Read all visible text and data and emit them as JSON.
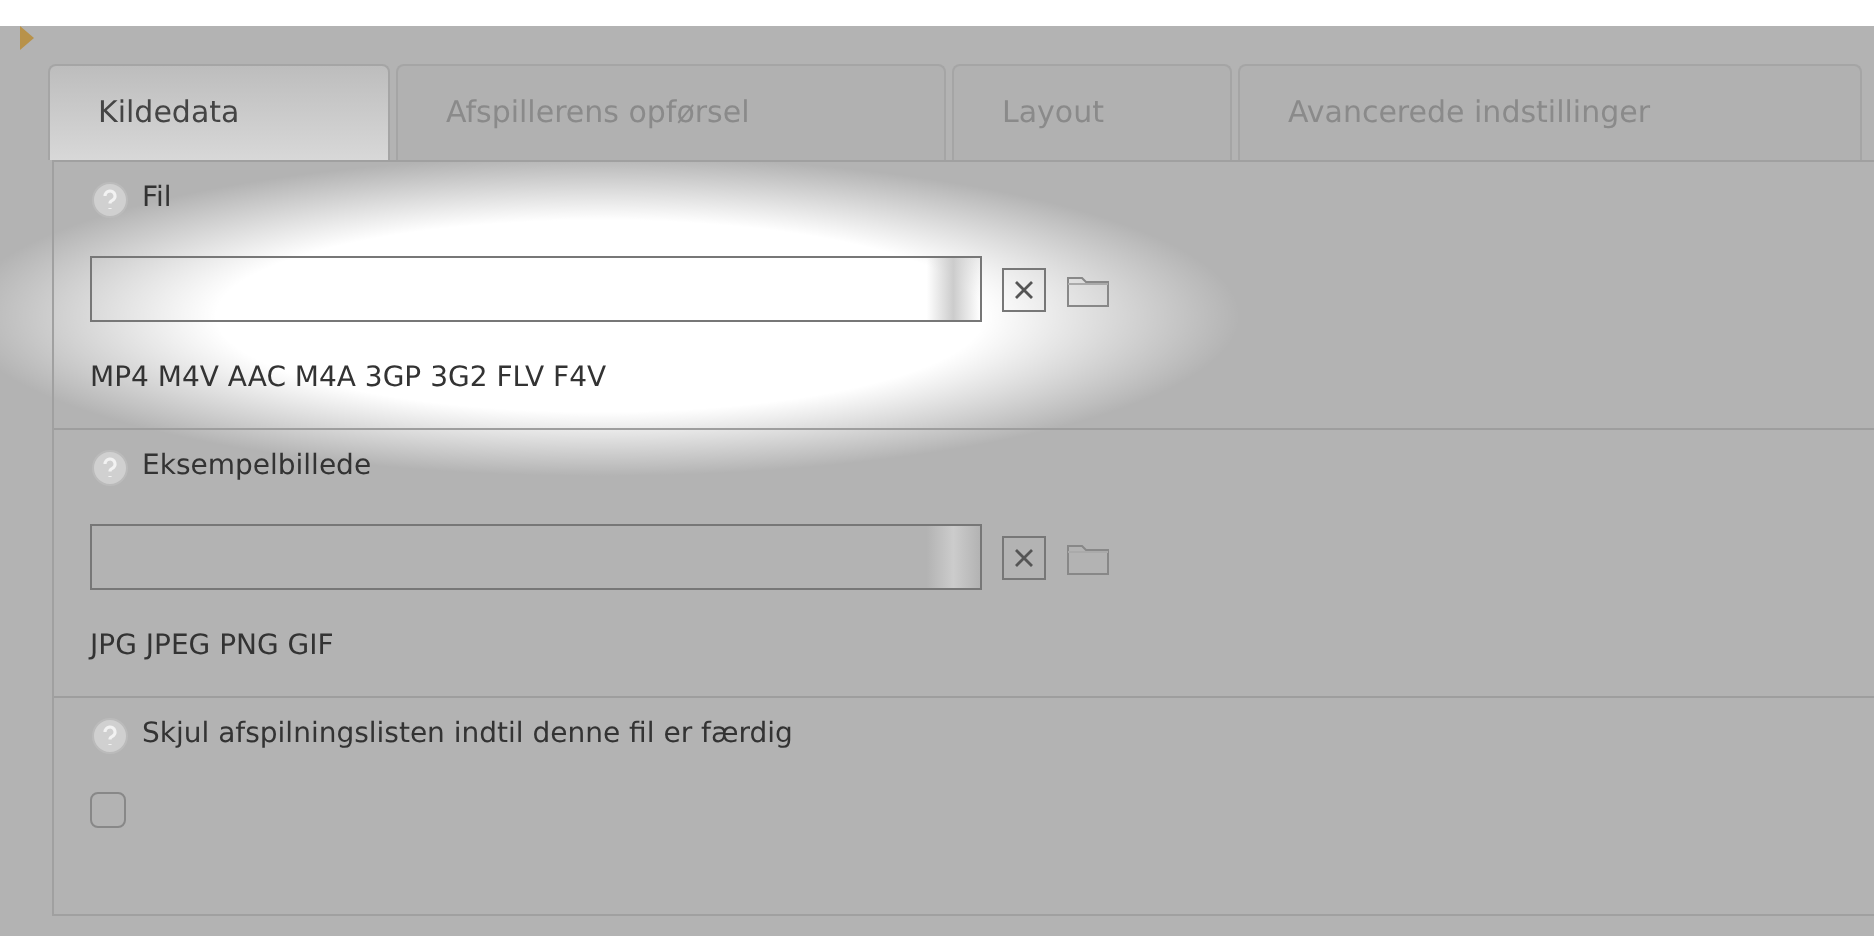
{
  "tabs": [
    {
      "label": "Kildedata",
      "selected": true
    },
    {
      "label": "Afspillerens opførsel",
      "selected": false
    },
    {
      "label": "Layout",
      "selected": false
    },
    {
      "label": "Avancerede indstillinger",
      "selected": false
    }
  ],
  "sections": [
    {
      "kind": "file",
      "label": "Fil",
      "formats": "MP4 M4V AAC M4A 3GP 3G2 FLV F4V"
    },
    {
      "kind": "file",
      "label": "Eksempelbillede",
      "formats": "JPG JPEG PNG GIF"
    },
    {
      "kind": "checkbox",
      "label": "Skjul afspilningslisten indtil denne fil er færdig",
      "checked": false
    }
  ]
}
